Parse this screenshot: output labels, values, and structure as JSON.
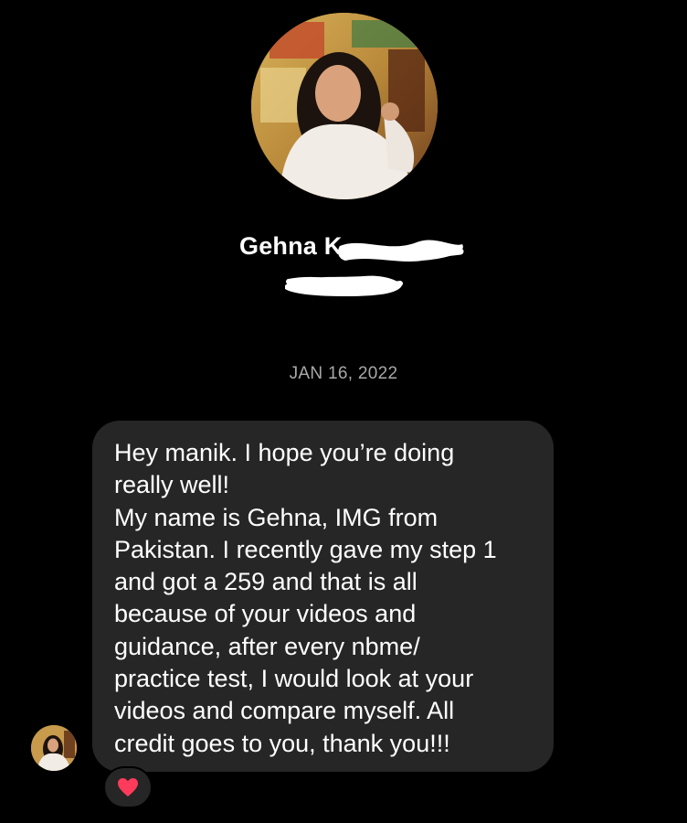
{
  "profile": {
    "name": "Gehna K",
    "photo_icon": "profile-photo"
  },
  "thread": {
    "date": "JAN 16, 2022"
  },
  "message": {
    "text": "Hey manik. I hope you’re doing\nreally well!\nMy name is Gehna, IMG from\nPakistan. I recently gave my step 1\nand got a 259 and that is all\nbecause of your videos and\nguidance, after every nbme/\npractice test, I would look at your\nvideos and compare myself. All\ncredit goes to you, thank you!!!",
    "reaction": "heart-icon",
    "reaction_color": "#ff3b5c"
  },
  "theme": {
    "background": "#000000",
    "bubble": "#262626",
    "muted_text": "#a8a8a8"
  }
}
